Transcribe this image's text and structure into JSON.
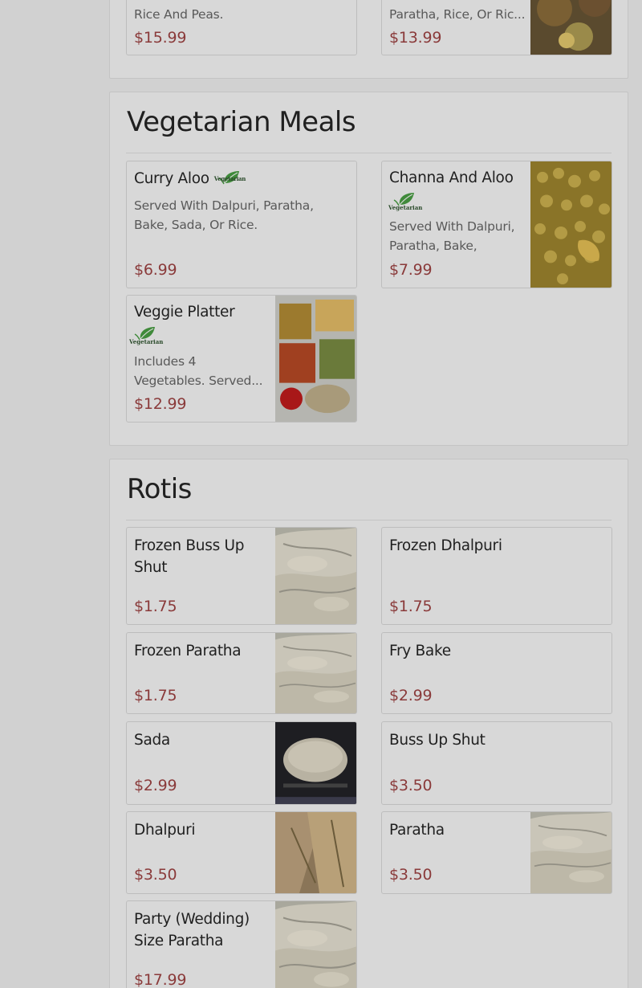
{
  "colors": {
    "price": "#8a3a3a",
    "veg_leaf": "#3f8a3a"
  },
  "top": {
    "card_left": {
      "desc": "Rice And Peas.",
      "price": "$15.99"
    },
    "card_right": {
      "desc": "Paratha, Rice, Or Ric...",
      "price": "$13.99"
    }
  },
  "vegetarian": {
    "title": "Vegetarian Meals",
    "veg_label": "Vegetarian",
    "items": [
      {
        "name": "Curry Aloo",
        "desc": "Served With Dalpuri, Paratha, Bake, Sada, Or Rice.",
        "price": "$6.99"
      },
      {
        "name": "Channa And Aloo",
        "desc": "Served With Dalpuri, Paratha, Bake, Sada,...",
        "price": "$7.99"
      },
      {
        "name": "Veggie Platter",
        "desc": "Includes 4 Vegetables. Served...",
        "price": "$12.99"
      }
    ]
  },
  "rotis": {
    "title": "Rotis",
    "items": [
      {
        "name": "Frozen Buss Up Shut",
        "price": "$1.75"
      },
      {
        "name": "Frozen Dhalpuri",
        "price": "$1.75"
      },
      {
        "name": "Frozen Paratha",
        "price": "$1.75"
      },
      {
        "name": "Fry Bake",
        "price": "$2.99"
      },
      {
        "name": "Sada",
        "price": "$2.99"
      },
      {
        "name": "Buss Up Shut",
        "price": "$3.50"
      },
      {
        "name": "Dhalpuri",
        "price": "$3.50"
      },
      {
        "name": "Paratha",
        "price": "$3.50"
      },
      {
        "name": "Party (Wedding) Size Paratha",
        "price": "$17.99"
      }
    ]
  }
}
